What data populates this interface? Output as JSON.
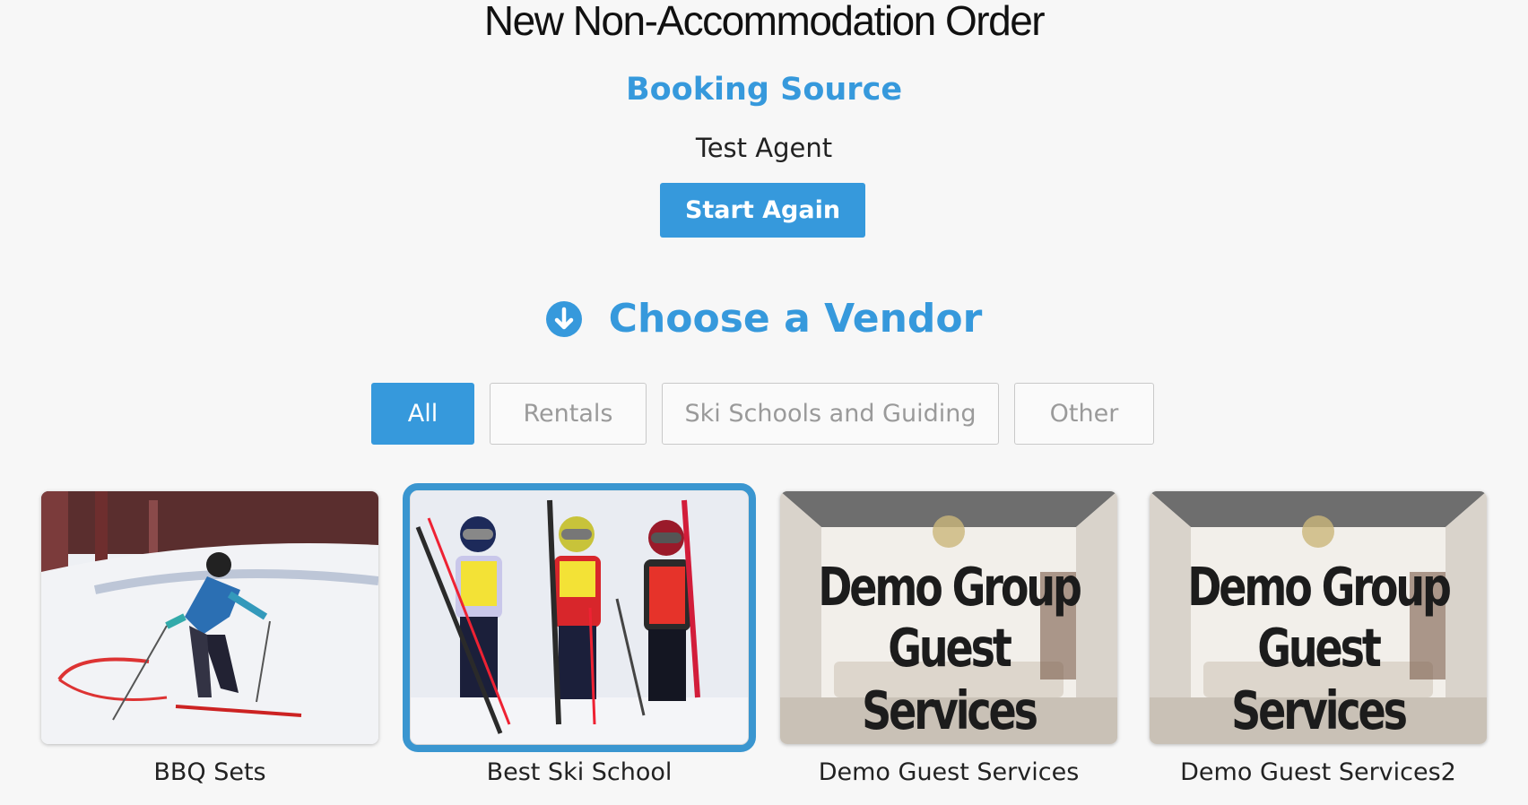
{
  "header": {
    "title": "New Non-Accommodation Order"
  },
  "booking_source": {
    "heading": "Booking Source",
    "value": "Test Agent",
    "start_again_label": "Start Again"
  },
  "vendor_section": {
    "heading": "Choose a Vendor",
    "icon": "arrow-down-circle-icon",
    "filters": [
      {
        "label": "All",
        "active": true
      },
      {
        "label": "Rentals",
        "active": false
      },
      {
        "label": "Ski Schools and Guiding",
        "active": false
      },
      {
        "label": "Other",
        "active": false
      }
    ],
    "vendors": [
      {
        "name": "BBQ Sets",
        "image": "skier-racing-photo",
        "selected": false
      },
      {
        "name": "Best Ski School",
        "image": "kids-with-skis-photo",
        "selected": true
      },
      {
        "name": "Demo Guest Services",
        "image": "demo-group-guest-services-banner",
        "image_text": [
          "Demo Group",
          "Guest Services"
        ],
        "selected": false
      },
      {
        "name": "Demo Guest Services2",
        "image": "demo-group-guest-services-banner",
        "image_text": [
          "Demo Group",
          "Guest Services"
        ],
        "selected": false
      }
    ]
  },
  "colors": {
    "accent": "#3699dc",
    "background": "#f7f7f7",
    "selected_outline": "#3a96d0"
  }
}
